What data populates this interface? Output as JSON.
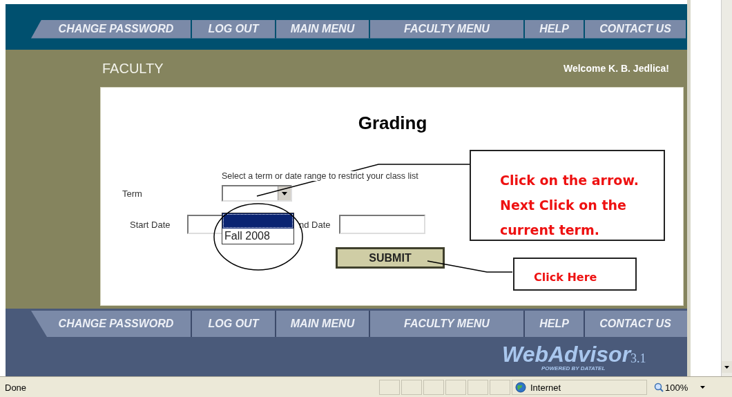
{
  "top_nav": [
    {
      "label": "CHANGE PASSWORD"
    },
    {
      "label": "LOG OUT"
    },
    {
      "label": "MAIN MENU"
    },
    {
      "label": "FACULTY MENU"
    },
    {
      "label": "HELP"
    },
    {
      "label": "CONTACT US"
    }
  ],
  "header": {
    "title": "FACULTY",
    "welcome": "Welcome K. B. Jedlica!"
  },
  "form": {
    "title": "Grading",
    "instruction": "Select a term or date range to restrict your class list",
    "term_label": "Term",
    "start_label": "Start Date",
    "end_label": "nd Date",
    "submit": "SUBMIT",
    "term_options": [
      {
        "kind": "blank",
        "selected": true
      },
      {
        "kind": "term",
        "label": "Fall 2008",
        "selected": false
      }
    ]
  },
  "bottom_nav": [
    {
      "label": "CHANGE PASSWORD"
    },
    {
      "label": "LOG OUT"
    },
    {
      "label": "MAIN MENU"
    },
    {
      "label": "FACULTY MENU"
    },
    {
      "label": "HELP"
    },
    {
      "label": "CONTACT US"
    }
  ],
  "logo": {
    "name": "WebAdvisor",
    "version": "3.1",
    "tagline": "POWERED BY DATATEL"
  },
  "annotations": [
    {
      "kind": "callout",
      "text": "Click on the arrow. Next Click on the current term."
    },
    {
      "kind": "button_callout",
      "text": "Click Here"
    }
  ],
  "status_bar": {
    "status": "Done",
    "zone": "Internet",
    "zoom": "100%"
  }
}
